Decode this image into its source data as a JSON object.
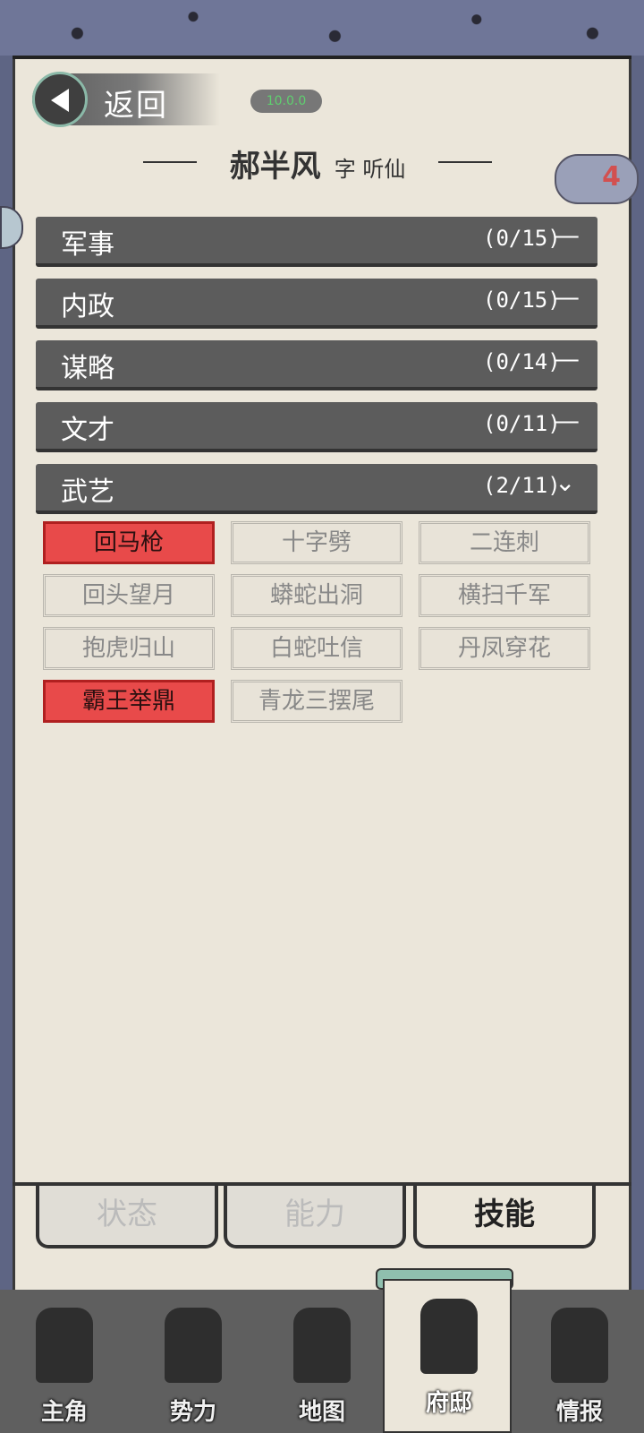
{
  "header": {
    "back_label": "返回",
    "version_badge": "10.0.0",
    "character_name": "郝半风",
    "character_style": "字 听仙",
    "notice_count": "4"
  },
  "categories": [
    {
      "name": "军事",
      "count": "(0/15)",
      "toggle": "—"
    },
    {
      "name": "内政",
      "count": "(0/15)",
      "toggle": "—"
    },
    {
      "name": "谋略",
      "count": "(0/14)",
      "toggle": "—"
    },
    {
      "name": "文才",
      "count": "(0/11)",
      "toggle": "—"
    },
    {
      "name": "武艺",
      "count": "(2/11)",
      "toggle": "⌄"
    }
  ],
  "skills": [
    {
      "label": "回马枪",
      "learned": true
    },
    {
      "label": "十字劈",
      "learned": false
    },
    {
      "label": "二连刺",
      "learned": false
    },
    {
      "label": "回头望月",
      "learned": false
    },
    {
      "label": "蟒蛇出洞",
      "learned": false
    },
    {
      "label": "横扫千军",
      "learned": false
    },
    {
      "label": "抱虎归山",
      "learned": false
    },
    {
      "label": "白蛇吐信",
      "learned": false
    },
    {
      "label": "丹凤穿花",
      "learned": false
    },
    {
      "label": "霸王举鼎",
      "learned": true
    },
    {
      "label": "青龙三摆尾",
      "learned": false
    }
  ],
  "tabs": [
    {
      "label": "状态",
      "active": false
    },
    {
      "label": "能力",
      "active": false
    },
    {
      "label": "技能",
      "active": true
    }
  ],
  "nav": [
    {
      "label": "主角",
      "icon": "hero-icon",
      "active": false
    },
    {
      "label": "势力",
      "icon": "flag-icon",
      "active": false
    },
    {
      "label": "地图",
      "icon": "map-icon",
      "active": false
    },
    {
      "label": "府邸",
      "icon": "mansion-icon",
      "active": true
    },
    {
      "label": "情报",
      "icon": "scroll-icon",
      "active": false
    }
  ],
  "colors": {
    "learned": "#e84a4a",
    "category_bar": "#5c5c5c",
    "paper": "#ebe6da"
  }
}
